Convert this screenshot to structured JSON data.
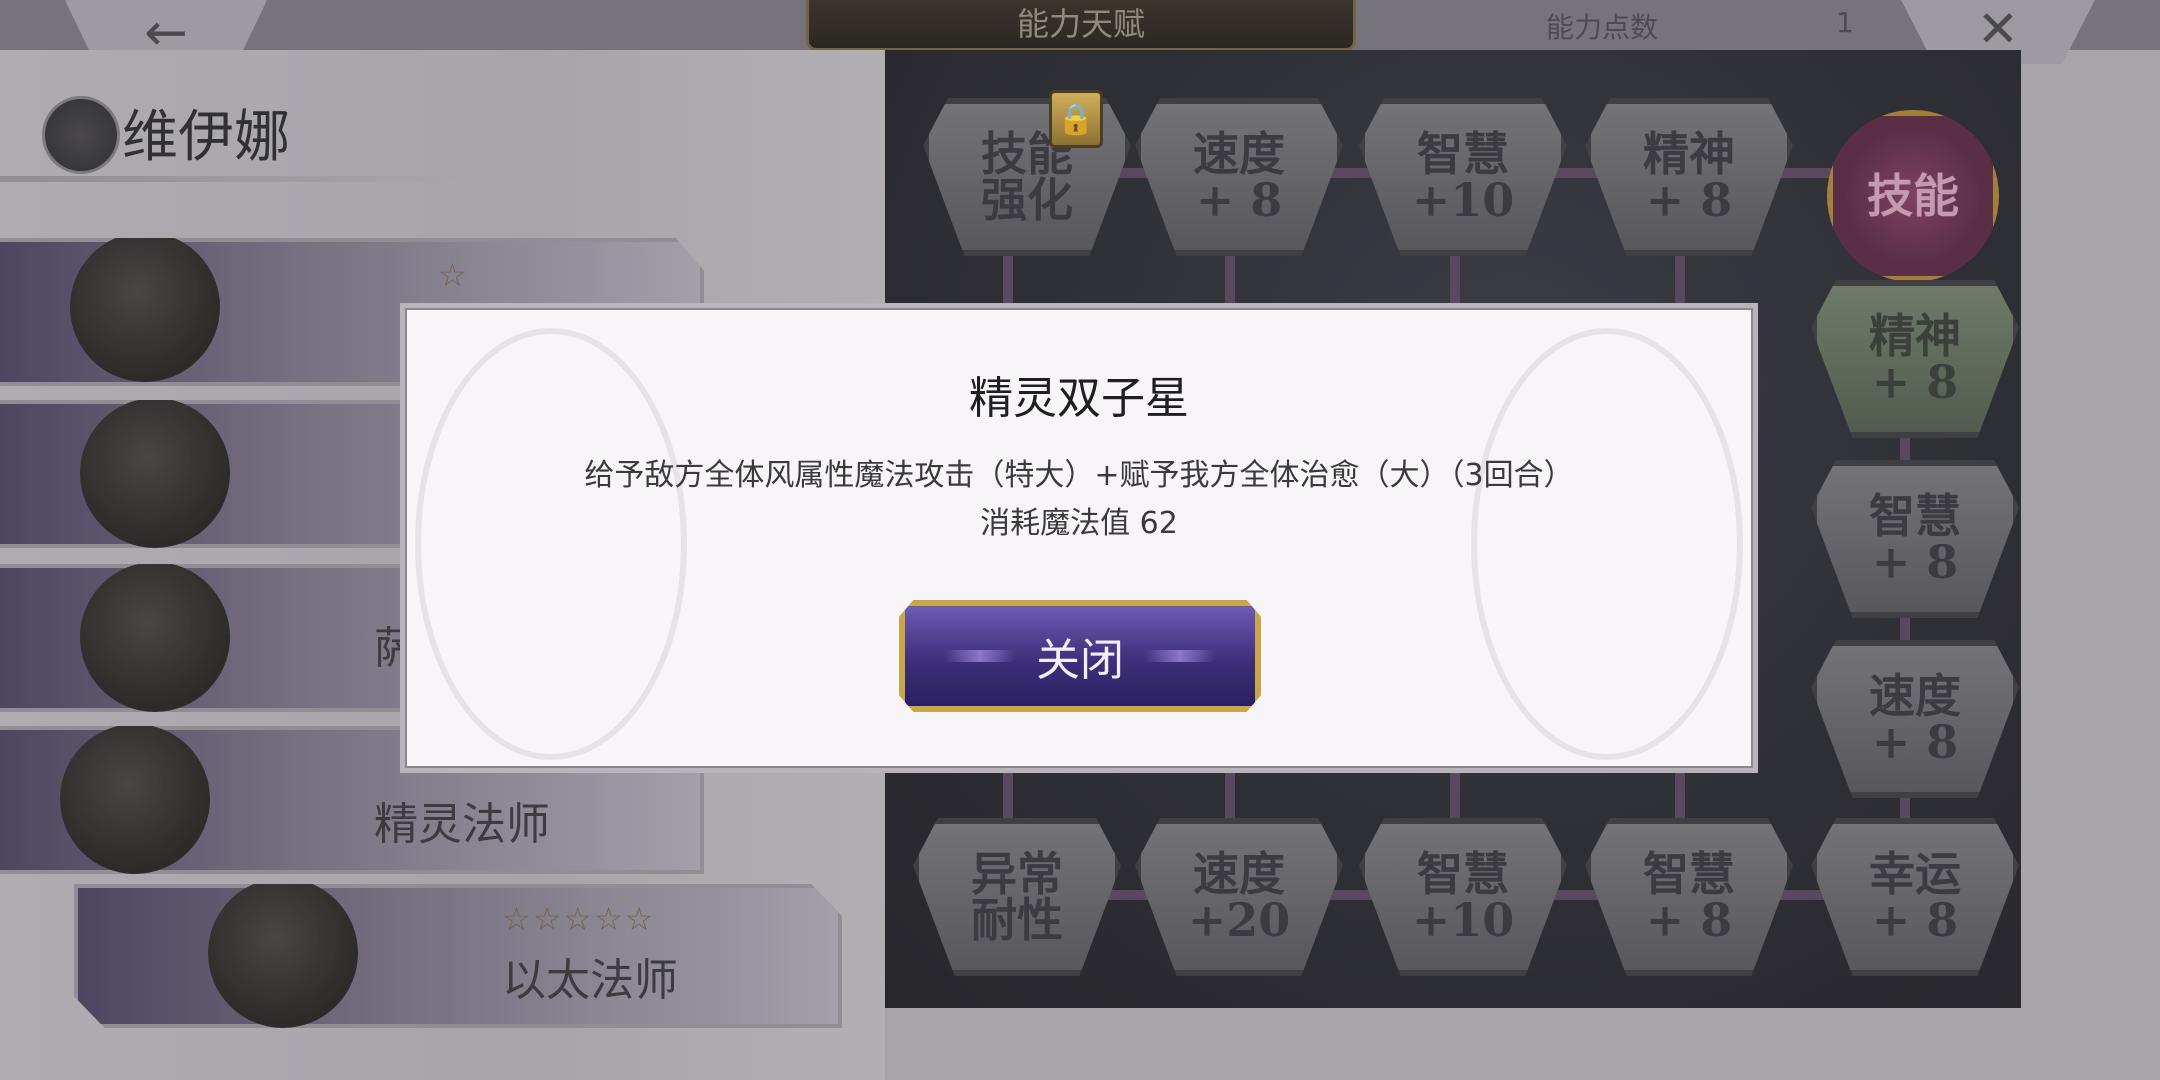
{
  "header": {
    "back_icon": "←",
    "title": "能力天赋",
    "points_label": "能力点数",
    "points_value": "1",
    "close_icon": "✕"
  },
  "character": {
    "name": "维伊娜"
  },
  "classes": [
    {
      "label": "",
      "stars": "☆",
      "state": "locked"
    },
    {
      "label": "",
      "stars": "",
      "state": "normal"
    },
    {
      "label": "萨",
      "stars": "",
      "state": "normal"
    },
    {
      "label": "精灵法师",
      "stars": "",
      "state": "normal"
    },
    {
      "label": "以太法师",
      "stars": "☆☆☆☆☆",
      "state": "selected"
    }
  ],
  "talent_nodes": {
    "row1": [
      "技能\n强化",
      "速度\n+ 8",
      "智慧\n+10",
      "精神\n+ 8",
      "技能"
    ],
    "right_column": [
      "精神\n+ 8",
      "智慧\n+ 8",
      "速度\n+ 8"
    ],
    "row_bottom": [
      "异常\n耐性",
      "速度\n+20",
      "智慧\n+10",
      "智慧\n+ 8",
      "幸运\n+ 8"
    ],
    "lock_icon": "🔒"
  },
  "modal": {
    "title": "精灵双子星",
    "description": "给予敌方全体风属性魔法攻击（特大）+赋予我方全体治愈（大）（3回合）",
    "cost": "消耗魔法值 62",
    "close_label": "关闭"
  }
}
